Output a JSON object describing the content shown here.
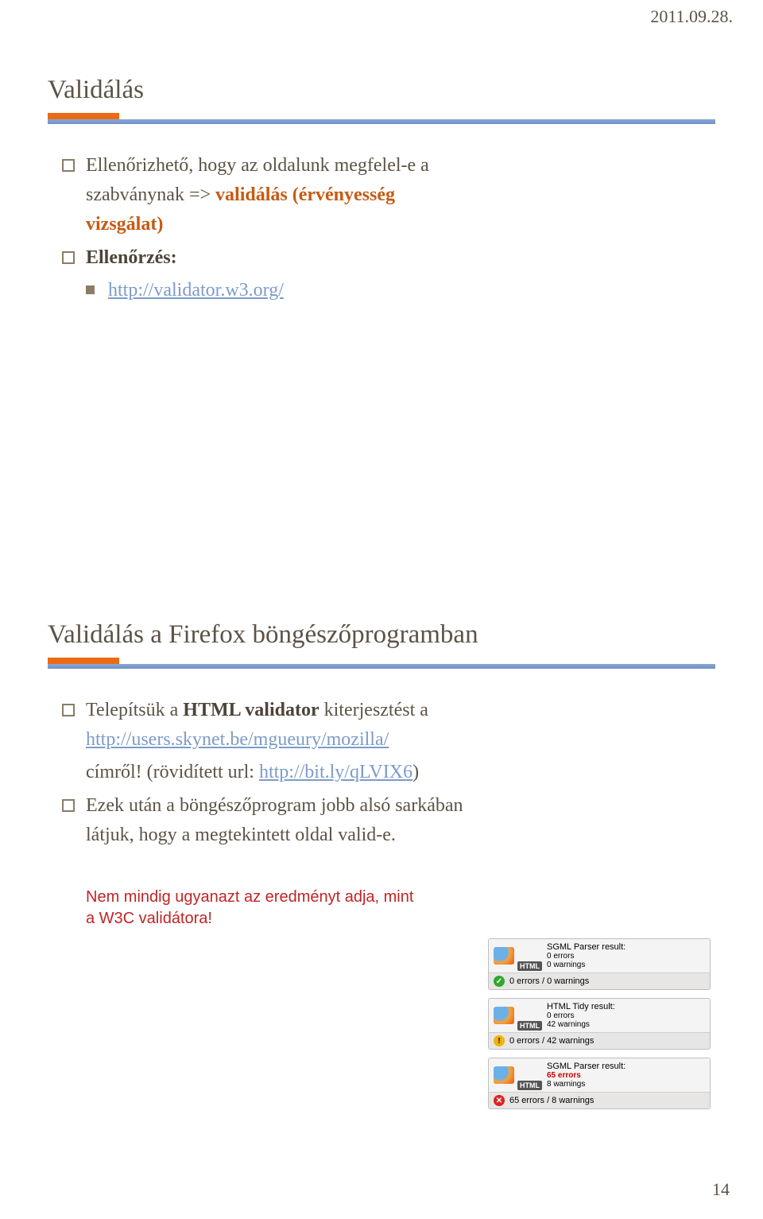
{
  "header": {
    "date": "2011.09.28."
  },
  "slide1": {
    "title": "Validálás",
    "line1_a": "Ellenőrizhető, hogy az oldalunk megfelel-e a",
    "line1_b": "szabványnak => ",
    "accent1": "validálás (érvényesség",
    "accent2": "vizsgálat)",
    "line2": "Ellenőrzés:",
    "link": "http://validator.w3.org/"
  },
  "slide2": {
    "title": "Validálás a Firefox böngészőprogramban",
    "line1_a": "Telepítsük a ",
    "bold1": "HTML validator",
    "line1_b": " kiterjesztést a",
    "link1": "http://users.skynet.be/mgueury/mozilla/",
    "line2_a": "címről! (rövidített url: ",
    "link2": "http://bit.ly/qLVIX6",
    "line2_b": ")",
    "line3_a": "Ezek után a böngészőprogram jobb alsó sarkában",
    "line3_b": "látjuk, hogy a megtekintett oldal valid-e.",
    "note_a": "Nem mindig ugyanazt az eredményt adja, mint",
    "note_b": "a W3C validátora!"
  },
  "badges": [
    {
      "engine": "SGML Parser result:",
      "errors": "0 errors",
      "warnings": "0 warnings",
      "html_label": "HTML",
      "status_icon": "green",
      "status_text": "0 errors / 0 warnings"
    },
    {
      "engine": "HTML Tidy result:",
      "errors": "0 errors",
      "warnings": "42 warnings",
      "html_label": "HTML",
      "status_icon": "yellow",
      "status_text": "0 errors / 42 warnings"
    },
    {
      "engine": "SGML Parser result:",
      "errors": "65 errors",
      "warnings": "8 warnings",
      "errors_red": true,
      "html_label": "HTML",
      "status_icon": "red",
      "status_text": "65 errors / 8 warnings"
    }
  ],
  "footer": {
    "page": "14"
  }
}
